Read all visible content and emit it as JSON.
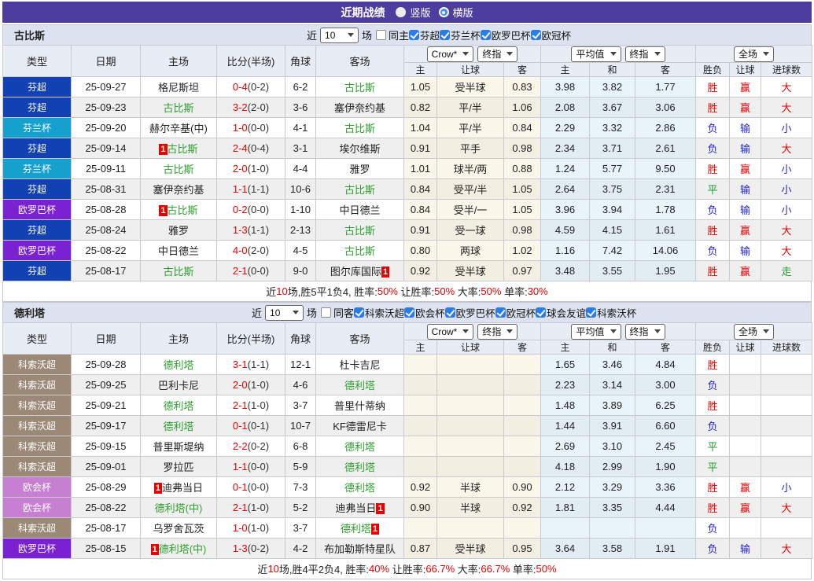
{
  "topbar": {
    "title": "近期战绩",
    "radio_vertical": "竖版",
    "radio_horizontal": "横版"
  },
  "columns": {
    "type": "类型",
    "date": "日期",
    "home": "主场",
    "score": "比分(半场)",
    "corner": "角球",
    "away": "客场",
    "ah_home": "主",
    "ah_line": "让球",
    "ah_away": "客",
    "eu_home": "主",
    "eu_draw": "和",
    "eu_away": "客",
    "res_wl": "胜负",
    "res_ah": "让球",
    "res_goal": "进球数"
  },
  "dropdowns": {
    "bookie": "Crow*",
    "final1": "终指",
    "avg": "平均值",
    "final2": "终指",
    "scope": "全场"
  },
  "league_colors": {
    "芬超": "#1241B4",
    "芬兰杯": "#16A0CE",
    "欧罗巴杯": "#7A21D2",
    "科索沃超": "#9B8876",
    "欧会杯": "#C77FD2"
  },
  "result_colors": {
    "胜": "red",
    "负": "blu",
    "平": "grn",
    "赢": "red",
    "输": "blu",
    "大": "red",
    "小": "blu",
    "走": "grn"
  },
  "tables": [
    {
      "team": "古比斯",
      "near": "近",
      "games": "10",
      "games_label": "场",
      "same_label": "同主",
      "leagues": [
        "芬超",
        "芬兰杯",
        "欧罗巴杯",
        "欧冠杯"
      ],
      "rows": [
        {
          "l": "芬超",
          "d": "25-09-27",
          "h": {
            "t": "格尼斯坦"
          },
          "s": "0-4",
          "hf": "(0-2)",
          "c": "6-2",
          "a": {
            "t": "古比斯",
            "g": 1
          },
          "ah": [
            "1.05",
            "受半球",
            "0.83"
          ],
          "eu": [
            "3.98",
            "3.82",
            "1.77"
          ],
          "r": [
            "胜",
            "赢",
            "大"
          ]
        },
        {
          "l": "芬超",
          "d": "25-09-23",
          "h": {
            "t": "古比斯",
            "g": 1
          },
          "s": "3-2",
          "hf": "(2-0)",
          "c": "3-6",
          "a": {
            "t": "塞伊奈约基"
          },
          "ah": [
            "0.82",
            "平/半",
            "1.06"
          ],
          "eu": [
            "2.08",
            "3.67",
            "3.06"
          ],
          "r": [
            "胜",
            "赢",
            "大"
          ]
        },
        {
          "l": "芬兰杯",
          "d": "25-09-20",
          "h": {
            "t": "赫尔辛基(中)"
          },
          "s": "1-0",
          "hf": "(0-0)",
          "c": "4-1",
          "a": {
            "t": "古比斯",
            "g": 1
          },
          "ah": [
            "1.04",
            "平/半",
            "0.84"
          ],
          "eu": [
            "2.29",
            "3.32",
            "2.86"
          ],
          "r": [
            "负",
            "输",
            "小"
          ]
        },
        {
          "l": "芬超",
          "d": "25-09-14",
          "h": {
            "t": "古比斯",
            "g": 1,
            "b": "pre"
          },
          "s": "2-4",
          "hf": "(0-4)",
          "c": "3-1",
          "a": {
            "t": "埃尔维斯"
          },
          "ah": [
            "0.91",
            "平手",
            "0.98"
          ],
          "eu": [
            "2.34",
            "3.71",
            "2.61"
          ],
          "r": [
            "负",
            "输",
            "大"
          ]
        },
        {
          "l": "芬兰杯",
          "d": "25-09-11",
          "h": {
            "t": "古比斯",
            "g": 1
          },
          "s": "2-0",
          "hf": "(1-0)",
          "c": "4-4",
          "a": {
            "t": "雅罗"
          },
          "ah": [
            "1.01",
            "球半/两",
            "0.88"
          ],
          "eu": [
            "1.24",
            "5.77",
            "9.50"
          ],
          "r": [
            "胜",
            "赢",
            "小"
          ]
        },
        {
          "l": "芬超",
          "d": "25-08-31",
          "h": {
            "t": "塞伊奈约基"
          },
          "s": "1-1",
          "hf": "(1-1)",
          "c": "10-6",
          "a": {
            "t": "古比斯",
            "g": 1
          },
          "ah": [
            "0.84",
            "受平/半",
            "1.05"
          ],
          "eu": [
            "2.64",
            "3.75",
            "2.31"
          ],
          "r": [
            "平",
            "输",
            "小"
          ]
        },
        {
          "l": "欧罗巴杯",
          "d": "25-08-28",
          "h": {
            "t": "古比斯",
            "g": 1,
            "b": "pre"
          },
          "s": "0-2",
          "hf": "(0-0)",
          "c": "1-10",
          "a": {
            "t": "中日德兰"
          },
          "ah": [
            "0.84",
            "受半/一",
            "1.05"
          ],
          "eu": [
            "3.96",
            "3.94",
            "1.78"
          ],
          "r": [
            "负",
            "输",
            "小"
          ]
        },
        {
          "l": "芬超",
          "d": "25-08-24",
          "h": {
            "t": "雅罗"
          },
          "s": "1-3",
          "hf": "(1-1)",
          "c": "2-13",
          "a": {
            "t": "古比斯",
            "g": 1
          },
          "ah": [
            "0.91",
            "受一球",
            "0.98"
          ],
          "eu": [
            "4.59",
            "4.15",
            "1.61"
          ],
          "r": [
            "胜",
            "赢",
            "大"
          ]
        },
        {
          "l": "欧罗巴杯",
          "d": "25-08-22",
          "h": {
            "t": "中日德兰"
          },
          "s": "4-0",
          "hf": "(2-0)",
          "c": "4-5",
          "a": {
            "t": "古比斯",
            "g": 1
          },
          "ah": [
            "0.80",
            "两球",
            "1.02"
          ],
          "eu": [
            "1.16",
            "7.42",
            "14.06"
          ],
          "r": [
            "负",
            "输",
            "大"
          ]
        },
        {
          "l": "芬超",
          "d": "25-08-17",
          "h": {
            "t": "古比斯",
            "g": 1
          },
          "s": "2-1",
          "hf": "(0-0)",
          "c": "9-0",
          "a": {
            "t": "图尔库国际",
            "b": "post"
          },
          "ah": [
            "0.92",
            "受半球",
            "0.97"
          ],
          "eu": [
            "3.48",
            "3.55",
            "1.95"
          ],
          "r": [
            "胜",
            "赢",
            "走"
          ]
        }
      ],
      "summary": [
        [
          "近",
          0
        ],
        [
          "10",
          1
        ],
        [
          "场,胜5平1负4, 胜率:",
          0
        ],
        [
          "50%",
          1
        ],
        [
          " 让胜率:",
          0
        ],
        [
          "50%",
          1
        ],
        [
          " 大率:",
          0
        ],
        [
          "50%",
          1
        ],
        [
          " 单率:",
          0
        ],
        [
          "30%",
          1
        ]
      ]
    },
    {
      "team": "德利塔",
      "near": "近",
      "games": "10",
      "games_label": "场",
      "same_label": "同客",
      "leagues": [
        "科索沃超",
        "欧会杯",
        "欧罗巴杯",
        "欧冠杯",
        "球会友谊",
        "科索沃杯"
      ],
      "rows": [
        {
          "l": "科索沃超",
          "d": "25-09-28",
          "h": {
            "t": "德利塔",
            "g": 1
          },
          "s": "3-1",
          "hf": "(1-1)",
          "c": "12-1",
          "a": {
            "t": "杜卡吉尼"
          },
          "ah": [
            "",
            "",
            ""
          ],
          "eu": [
            "1.65",
            "3.46",
            "4.84"
          ],
          "r": [
            "胜",
            "",
            ""
          ]
        },
        {
          "l": "科索沃超",
          "d": "25-09-25",
          "h": {
            "t": "巴利卡尼"
          },
          "s": "2-0",
          "hf": "(1-0)",
          "c": "4-6",
          "a": {
            "t": "德利塔",
            "g": 1
          },
          "ah": [
            "",
            "",
            ""
          ],
          "eu": [
            "2.23",
            "3.14",
            "3.00"
          ],
          "r": [
            "负",
            "",
            ""
          ]
        },
        {
          "l": "科索沃超",
          "d": "25-09-21",
          "h": {
            "t": "德利塔",
            "g": 1
          },
          "s": "2-1",
          "hf": "(1-0)",
          "c": "3-7",
          "a": {
            "t": "普里什蒂纳"
          },
          "ah": [
            "",
            "",
            ""
          ],
          "eu": [
            "1.48",
            "3.89",
            "6.25"
          ],
          "r": [
            "胜",
            "",
            ""
          ]
        },
        {
          "l": "科索沃超",
          "d": "25-09-17",
          "h": {
            "t": "德利塔",
            "g": 1
          },
          "s": "0-1",
          "hf": "(0-1)",
          "c": "10-7",
          "a": {
            "t": "KF德雷尼卡"
          },
          "ah": [
            "",
            "",
            ""
          ],
          "eu": [
            "1.44",
            "3.91",
            "6.60"
          ],
          "r": [
            "负",
            "",
            ""
          ]
        },
        {
          "l": "科索沃超",
          "d": "25-09-15",
          "h": {
            "t": "普里斯堤纳"
          },
          "s": "2-2",
          "hf": "(0-2)",
          "c": "6-8",
          "a": {
            "t": "德利塔",
            "g": 1
          },
          "ah": [
            "",
            "",
            ""
          ],
          "eu": [
            "2.69",
            "3.10",
            "2.45"
          ],
          "r": [
            "平",
            "",
            ""
          ]
        },
        {
          "l": "科索沃超",
          "d": "25-09-01",
          "h": {
            "t": "罗拉匹"
          },
          "s": "1-1",
          "hf": "(0-0)",
          "c": "5-9",
          "a": {
            "t": "德利塔",
            "g": 1
          },
          "ah": [
            "",
            "",
            ""
          ],
          "eu": [
            "4.18",
            "2.99",
            "1.90"
          ],
          "r": [
            "平",
            "",
            ""
          ]
        },
        {
          "l": "欧会杯",
          "d": "25-08-29",
          "h": {
            "t": "迪弗当日",
            "b": "pre"
          },
          "s": "0-1",
          "hf": "(0-0)",
          "c": "7-3",
          "a": {
            "t": "德利塔",
            "g": 1
          },
          "ah": [
            "0.92",
            "半球",
            "0.90"
          ],
          "eu": [
            "2.12",
            "3.29",
            "3.36"
          ],
          "r": [
            "胜",
            "赢",
            "小"
          ]
        },
        {
          "l": "欧会杯",
          "d": "25-08-22",
          "h": {
            "t": "德利塔(中)",
            "g": 1
          },
          "s": "2-1",
          "hf": "(1-0)",
          "c": "5-2",
          "a": {
            "t": "迪弗当日",
            "b": "post"
          },
          "ah": [
            "0.90",
            "半球",
            "0.92"
          ],
          "eu": [
            "1.81",
            "3.35",
            "4.44"
          ],
          "r": [
            "胜",
            "赢",
            "大"
          ]
        },
        {
          "l": "科索沃超",
          "d": "25-08-17",
          "h": {
            "t": "乌罗舍瓦茨"
          },
          "s": "1-0",
          "hf": "(1-0)",
          "c": "3-7",
          "a": {
            "t": "德利塔",
            "g": 1,
            "b": "post"
          },
          "ah": [
            "",
            "",
            ""
          ],
          "eu": [
            "",
            "",
            ""
          ],
          "r": [
            "负",
            "",
            ""
          ]
        },
        {
          "l": "欧罗巴杯",
          "d": "25-08-15",
          "h": {
            "t": "德利塔(中)",
            "g": 1,
            "b": "pre"
          },
          "s": "1-3",
          "hf": "(0-2)",
          "c": "4-2",
          "a": {
            "t": "布加勒斯特星队"
          },
          "ah": [
            "0.87",
            "受半球",
            "0.95"
          ],
          "eu": [
            "3.64",
            "3.58",
            "1.91"
          ],
          "r": [
            "负",
            "输",
            "大"
          ]
        }
      ],
      "summary": [
        [
          "近",
          0
        ],
        [
          "10",
          1
        ],
        [
          "场,胜4平2负4, 胜率:",
          0
        ],
        [
          "40%",
          1
        ],
        [
          " 让胜率:",
          0
        ],
        [
          "66.7%",
          1
        ],
        [
          " 大率:",
          0
        ],
        [
          "66.7%",
          1
        ],
        [
          " 单率:",
          0
        ],
        [
          "50%",
          1
        ]
      ]
    }
  ]
}
